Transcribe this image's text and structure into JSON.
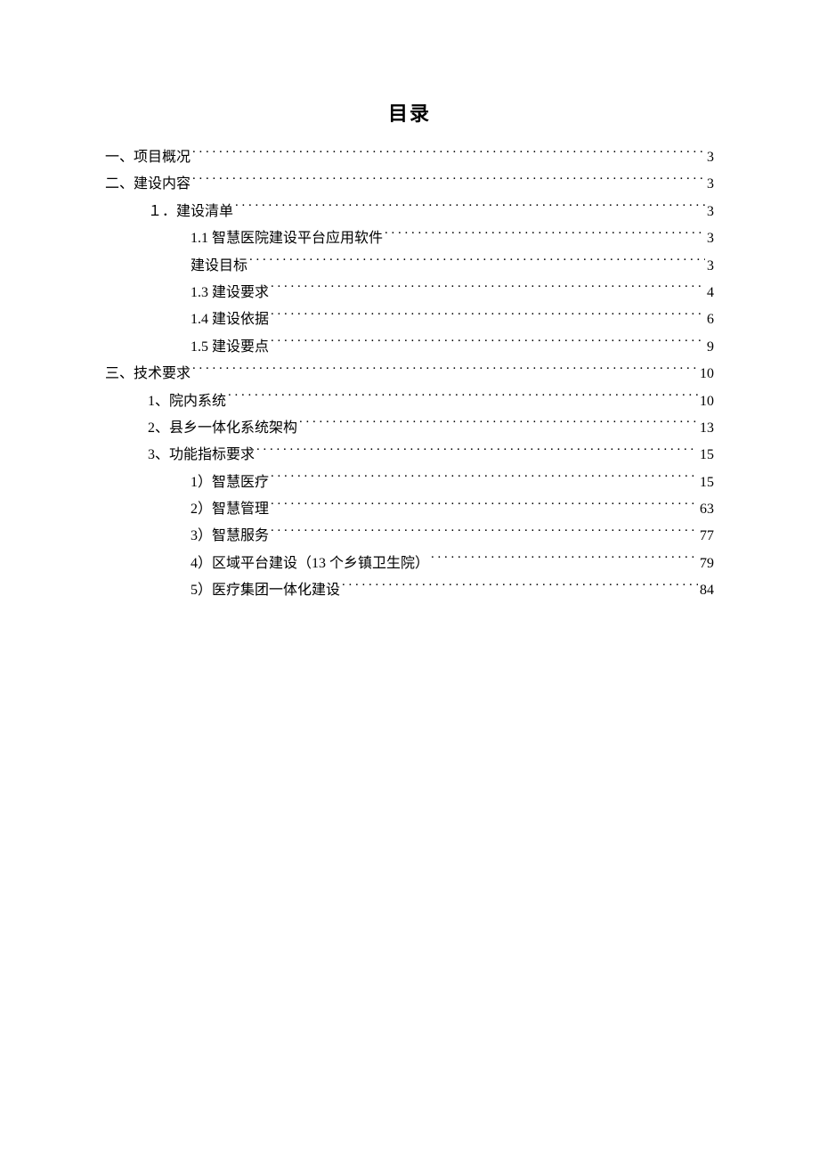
{
  "title": "目录",
  "entries": [
    {
      "label": "一、项目概况",
      "page": "3",
      "indent": 0
    },
    {
      "label": "二、建设内容",
      "page": "3",
      "indent": 0
    },
    {
      "label": "１．建设清单",
      "page": "3",
      "indent": 1
    },
    {
      "label": "1.1 智慧医院建设平台应用软件",
      "page": "3",
      "indent": 2
    },
    {
      "label": "建设目标",
      "page": "3",
      "indent": 2
    },
    {
      "label": "1.3 建设要求",
      "page": "4",
      "indent": 2
    },
    {
      "label": "1.4 建设依据",
      "page": "6",
      "indent": 2
    },
    {
      "label": "1.5 建设要点",
      "page": "9",
      "indent": 2
    },
    {
      "label": "三、技术要求",
      "page": "10",
      "indent": 0
    },
    {
      "label": "1、院内系统",
      "page": "10",
      "indent": 1
    },
    {
      "label": "2、县乡一体化系统架构",
      "page": "13",
      "indent": 1
    },
    {
      "label": "3、功能指标要求",
      "page": "15",
      "indent": 1
    },
    {
      "label": "1）智慧医疗",
      "page": "15",
      "indent": 2
    },
    {
      "label": "2）智慧管理",
      "page": "63",
      "indent": 2
    },
    {
      "label": "3）智慧服务",
      "page": "77",
      "indent": 2
    },
    {
      "label": "4）区域平台建设（13 个乡镇卫生院）",
      "page": "79",
      "indent": 2
    },
    {
      "label": "5）医疗集团一体化建设",
      "page": "84",
      "indent": 2
    }
  ]
}
